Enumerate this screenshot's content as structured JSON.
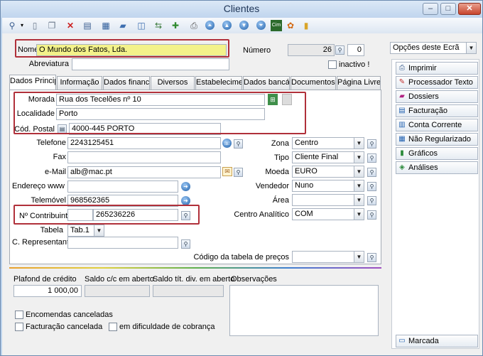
{
  "window": {
    "title": "Clientes",
    "minimize": "–",
    "maximize": "□",
    "close": "✕"
  },
  "toolbar": {
    "icons": [
      "search-icon",
      "new-icon",
      "copy-icon",
      "delete-icon",
      "edit-icon",
      "grid-icon",
      "folder-icon",
      "book-icon",
      "transfer-icon",
      "preview-icon",
      "first-icon",
      "prev-icon",
      "next-icon",
      "last-icon",
      "cim-icon",
      "refresh-icon",
      "notes-icon"
    ]
  },
  "form": {
    "nome_label": "Nome",
    "nome_value": "O Mundo dos Fatos, Lda.",
    "numero_label": "Número",
    "numero_value": "26",
    "numero_sub": "0",
    "abreviatura_label": "Abreviatura",
    "abreviatura_value": "",
    "inactivo_label": "inactivo !"
  },
  "tabs": [
    "Dados Principai",
    "Informação",
    "Dados financeir",
    "Diversos",
    "Estabeleciment",
    "Dados bancário",
    "Documentos de",
    "Página Livre"
  ],
  "address": {
    "morada_label": "Morada",
    "morada_value": "Rua dos Tecelões nº 10",
    "localidade_label": "Localidade",
    "localidade_value": "Porto",
    "cod_postal_label": "Cód. Postal",
    "cod_postal_value": "4000-445 PORTO"
  },
  "contacts": {
    "telefone_label": "Telefone",
    "telefone_value": "2243125451",
    "fax_label": "Fax",
    "fax_value": "",
    "email_label": "e-Mail",
    "email_value": "alb@mac.pt",
    "www_label": "Endereço www",
    "www_value": "",
    "telemovel_label": "Telemóvel",
    "telemovel_value": "968562365",
    "contribuinte_label": "Nº Contribuinte",
    "contribuinte_prefix": "",
    "contribuinte_value": "265236226",
    "tabela_label": "Tabela",
    "tabela_value": "Tab.1",
    "representante_label": "C. Representante",
    "representante_value": ""
  },
  "right": {
    "zona_label": "Zona",
    "zona_value": "Centro",
    "tipo_label": "Tipo",
    "tipo_value": "Cliente Final",
    "moeda_label": "Moeda",
    "moeda_value": "EURO",
    "vendedor_label": "Vendedor",
    "vendedor_value": "Nuno",
    "area_label": "Área",
    "area_value": "",
    "centro_label": "Centro Analítico",
    "centro_value": "COM",
    "codtab_label": "Código da tabela de preços",
    "codtab_value": ""
  },
  "finance": {
    "plafond_label": "Plafond de crédito",
    "plafond_value": "1 000,00",
    "saldo_label": "Saldo c/c em aberto",
    "saldo_value": "",
    "saldotit_label": "Saldo tít. div. em aberto",
    "saldotit_value": "",
    "obs_label": "Observações",
    "obs_value": ""
  },
  "flags": {
    "encomendas": "Encomendas canceladas",
    "facturacao": "Facturação cancelada",
    "dificuldade": "em dificuldade de cobrança"
  },
  "side": {
    "options_label": "Opções deste Ecrã",
    "buttons": [
      "Imprimir",
      "Processador Texto",
      "Dossiers",
      "Facturação",
      "Conta Corrente",
      "Não Regularizado",
      "Gráficos",
      "Análises"
    ],
    "marcada": "Marcada"
  }
}
